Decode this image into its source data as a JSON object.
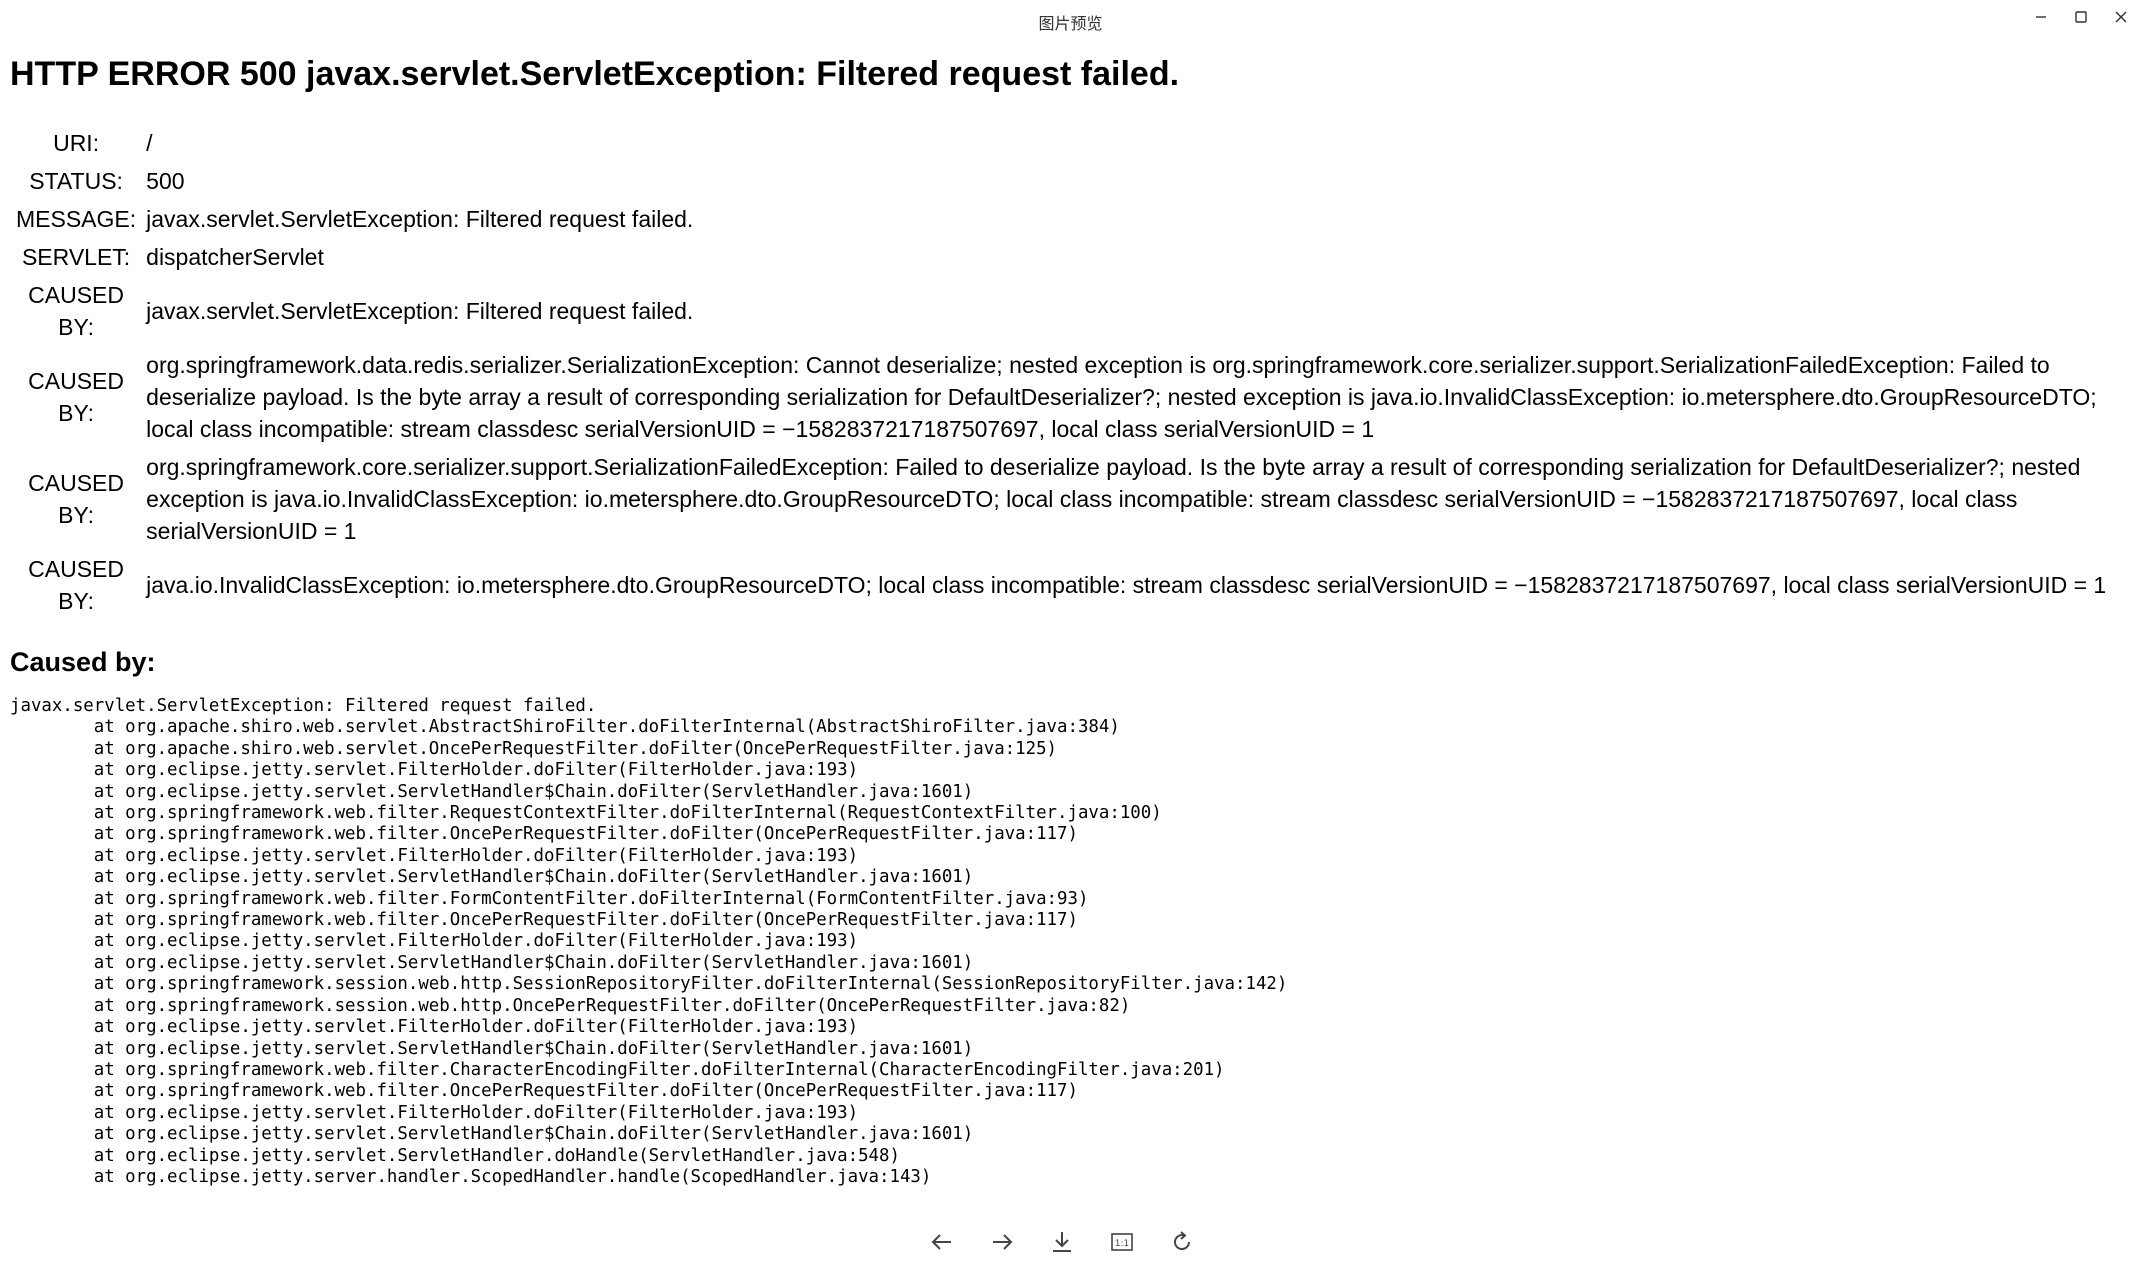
{
  "window": {
    "title": "图片预览"
  },
  "page": {
    "heading": "HTTP ERROR 500 javax.servlet.ServletException: Filtered request failed.",
    "rows": [
      {
        "label": "URI:",
        "value": "/"
      },
      {
        "label": "STATUS:",
        "value": "500"
      },
      {
        "label": "MESSAGE:",
        "value": "javax.servlet.ServletException: Filtered request failed."
      },
      {
        "label": "SERVLET:",
        "value": "dispatcherServlet"
      },
      {
        "label": "CAUSED BY:",
        "value": "javax.servlet.ServletException: Filtered request failed."
      },
      {
        "label": "CAUSED BY:",
        "value": "org.springframework.data.redis.serializer.SerializationException: Cannot deserialize; nested exception is org.springframework.core.serializer.support.SerializationFailedException: Failed to deserialize payload. Is the byte array a result of corresponding serialization for DefaultDeserializer?; nested exception is java.io.InvalidClassException: io.metersphere.dto.GroupResourceDTO; local class incompatible: stream classdesc serialVersionUID = −1582837217187507697, local class serialVersionUID = 1"
      },
      {
        "label": "CAUSED BY:",
        "value": "org.springframework.core.serializer.support.SerializationFailedException: Failed to deserialize payload. Is the byte array a result of corresponding serialization for DefaultDeserializer?; nested exception is java.io.InvalidClassException: io.metersphere.dto.GroupResourceDTO; local class incompatible: stream classdesc serialVersionUID = −1582837217187507697, local class serialVersionUID = 1"
      },
      {
        "label": "CAUSED BY:",
        "value": "java.io.InvalidClassException: io.metersphere.dto.GroupResourceDTO; local class incompatible: stream classdesc serialVersionUID = −1582837217187507697, local class serialVersionUID = 1"
      }
    ],
    "caused_by_heading": "Caused by:",
    "stack_trace": "javax.servlet.ServletException: Filtered request failed.\n\tat org.apache.shiro.web.servlet.AbstractShiroFilter.doFilterInternal(AbstractShiroFilter.java:384)\n\tat org.apache.shiro.web.servlet.OncePerRequestFilter.doFilter(OncePerRequestFilter.java:125)\n\tat org.eclipse.jetty.servlet.FilterHolder.doFilter(FilterHolder.java:193)\n\tat org.eclipse.jetty.servlet.ServletHandler$Chain.doFilter(ServletHandler.java:1601)\n\tat org.springframework.web.filter.RequestContextFilter.doFilterInternal(RequestContextFilter.java:100)\n\tat org.springframework.web.filter.OncePerRequestFilter.doFilter(OncePerRequestFilter.java:117)\n\tat org.eclipse.jetty.servlet.FilterHolder.doFilter(FilterHolder.java:193)\n\tat org.eclipse.jetty.servlet.ServletHandler$Chain.doFilter(ServletHandler.java:1601)\n\tat org.springframework.web.filter.FormContentFilter.doFilterInternal(FormContentFilter.java:93)\n\tat org.springframework.web.filter.OncePerRequestFilter.doFilter(OncePerRequestFilter.java:117)\n\tat org.eclipse.jetty.servlet.FilterHolder.doFilter(FilterHolder.java:193)\n\tat org.eclipse.jetty.servlet.ServletHandler$Chain.doFilter(ServletHandler.java:1601)\n\tat org.springframework.session.web.http.SessionRepositoryFilter.doFilterInternal(SessionRepositoryFilter.java:142)\n\tat org.springframework.session.web.http.OncePerRequestFilter.doFilter(OncePerRequestFilter.java:82)\n\tat org.eclipse.jetty.servlet.FilterHolder.doFilter(FilterHolder.java:193)\n\tat org.eclipse.jetty.servlet.ServletHandler$Chain.doFilter(ServletHandler.java:1601)\n\tat org.springframework.web.filter.CharacterEncodingFilter.doFilterInternal(CharacterEncodingFilter.java:201)\n\tat org.springframework.web.filter.OncePerRequestFilter.doFilter(OncePerRequestFilter.java:117)\n\tat org.eclipse.jetty.servlet.FilterHolder.doFilter(FilterHolder.java:193)\n\tat org.eclipse.jetty.servlet.ServletHandler$Chain.doFilter(ServletHandler.java:1601)\n\tat org.eclipse.jetty.servlet.ServletHandler.doHandle(ServletHandler.java:548)\n\tat org.eclipse.jetty.server.handler.ScopedHandler.handle(ScopedHandler.java:143)"
  },
  "toolbar": {
    "icons": [
      "arrow-left-icon",
      "arrow-right-icon",
      "download-icon",
      "actual-size-icon",
      "rotate-icon"
    ],
    "actual_size_label": "1:1"
  },
  "window_controls": [
    "minimize-icon",
    "maximize-icon",
    "close-icon"
  ]
}
